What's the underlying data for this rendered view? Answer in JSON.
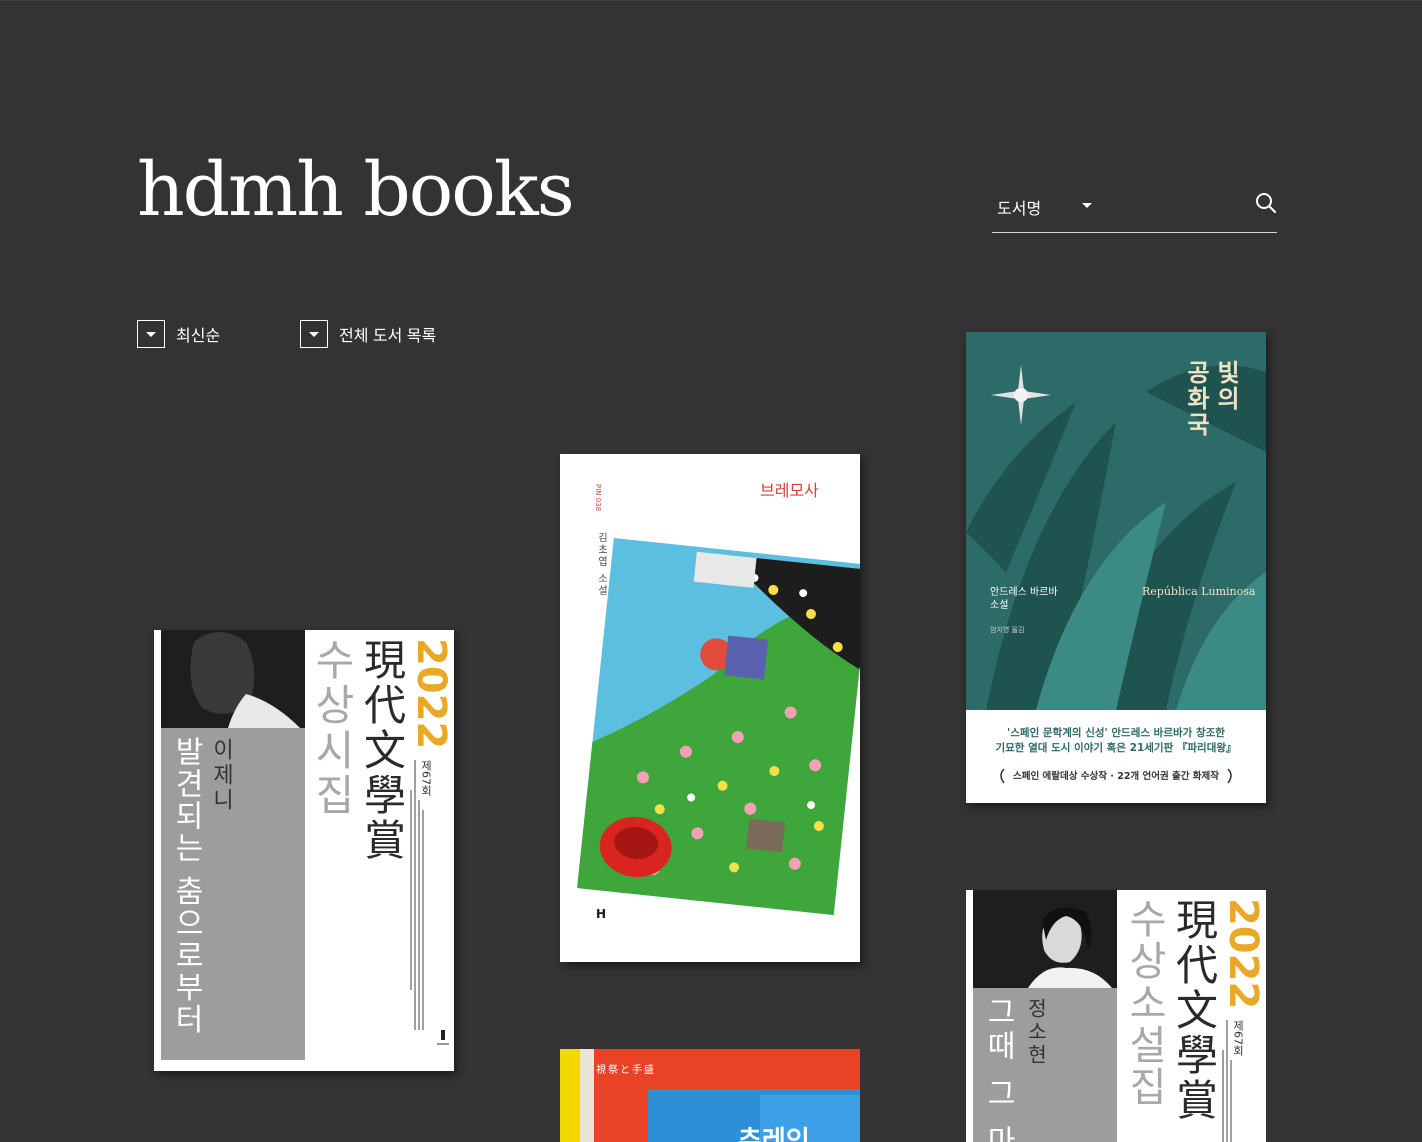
{
  "brand": {
    "logo": "hdmh books"
  },
  "search": {
    "type_label": "도서명",
    "placeholder": ""
  },
  "filters": {
    "sort_label": "최신순",
    "category_label": "전체 도서 목록"
  },
  "books": [
    {
      "id": "book-1",
      "year": "2022",
      "series_hanja": "現代文學賞",
      "collection": "수상시집",
      "author": "이제니",
      "title": "발견되는 춤으로부터",
      "edition": "제67회"
    },
    {
      "id": "book-2",
      "title": "브레모사",
      "author_line": "김초엽 소설",
      "series_code": "PIN 038",
      "imprint_mark": "H"
    },
    {
      "id": "book-3",
      "title_line_1": "빛의",
      "title_line_2": "공화국",
      "author_line_1": "안드레스 바르바",
      "author_line_2": "소설",
      "translator": "엄지영 옮김",
      "original_title": "República Luminosa",
      "blurb_line_1": "'스페인 문학계의 신성' 안드레스 바르바가 창조한",
      "blurb_line_2": "기묘한 열대 도시 이야기 혹은 21세기판 『파리대왕』",
      "blurb_line_3": "스페인 에랄데상 수상작 · 22개 언어권 출간 화제작"
    },
    {
      "id": "book-4",
      "top_text": "視祭と手盛",
      "title_partial": "추레인"
    },
    {
      "id": "book-5",
      "year": "2022",
      "series_hanja": "現代文學賞",
      "collection": "수상소설집",
      "author": "정소현",
      "title_partial": "그때 그 마",
      "edition": "제67회"
    }
  ],
  "colors": {
    "background": "#333333",
    "award_yellow": "#e9a825",
    "award_gray": "#9b9b9b",
    "republic_teal": "#2e6a66"
  }
}
